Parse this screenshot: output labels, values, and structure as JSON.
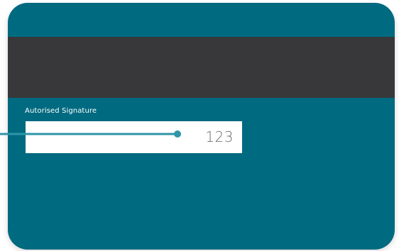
{
  "colors": {
    "card": "#006a80",
    "stripe": "#38383a",
    "signature_strip": "#ffffff",
    "pointer": "#2f95a8",
    "label": "#ffffff",
    "cvv": "#6b6b6b"
  },
  "card": {
    "signature_label": "Autorised Signature",
    "cvv": "123"
  }
}
